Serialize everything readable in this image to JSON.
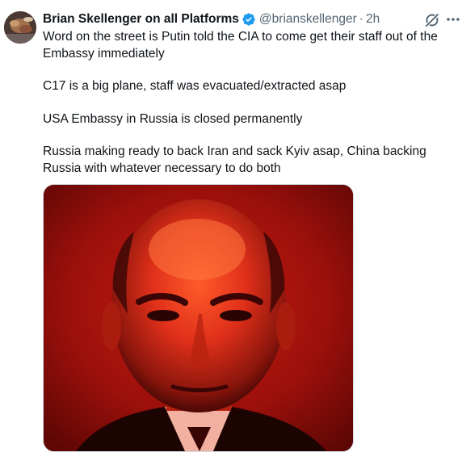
{
  "tweet": {
    "author": {
      "display_name": "Brian Skellenger on all Platforms",
      "handle": "@brianskellenger",
      "separator": "·",
      "timestamp": "2h",
      "verified": true
    },
    "paragraphs": [
      "Word on the street is Putin told the CIA to come get their staff out of the Embassy immediately",
      "C17 is a big plane, staff was evacuated/extracted asap",
      "USA Embassy in Russia is closed permanently",
      "Russia making ready to back Iran and sack Kyiv asap, China backing Russia with whatever necessary to do both"
    ],
    "icons": {
      "verified": "verified-badge-icon",
      "grok": "grok-icon",
      "more": "more-options-icon"
    },
    "colors": {
      "verified_blue": "#1d9bf0",
      "secondary_text": "#536471",
      "media_background": "#8b0e0b"
    }
  }
}
